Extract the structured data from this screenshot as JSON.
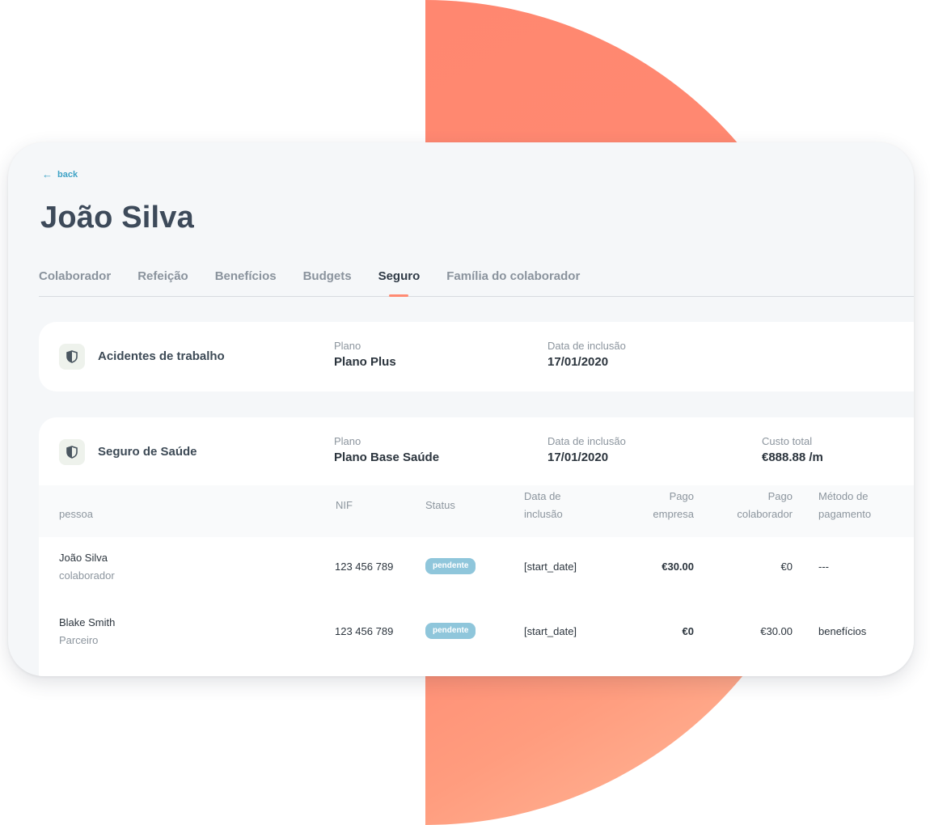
{
  "back_label": "back",
  "page_title": "João Silva",
  "tabs": [
    {
      "label": "Colaborador"
    },
    {
      "label": "Refeição"
    },
    {
      "label": "Benefícios"
    },
    {
      "label": "Budgets"
    },
    {
      "label": "Seguro",
      "active": true
    },
    {
      "label": "Família do colaborador"
    }
  ],
  "insurance_work": {
    "name": "Acidentes de trabalho",
    "plan_label": "Plano",
    "plan_value": "Plano Plus",
    "date_label": "Data de inclusão",
    "date_value": "17/01/2020"
  },
  "insurance_health": {
    "name": "Seguro de Saúde",
    "plan_label": "Plano",
    "plan_value": "Plano Base Saúde",
    "date_label": "Data de inclusão",
    "date_value": "17/01/2020",
    "cost_label": "Custo total",
    "cost_value": "€888.88 /m",
    "table": {
      "headers": {
        "person": "pessoa",
        "nif": "NIF",
        "status": "Status",
        "date_l1": "Data de",
        "date_l2": "inclusão",
        "company_l1": "Pago",
        "company_l2": "empresa",
        "employee_l1": "Pago",
        "employee_l2": "colaborador",
        "method_l1": "Método de",
        "method_l2": "pagamento"
      },
      "rows": [
        {
          "name": "João Silva",
          "role": "colaborador",
          "nif": "123 456 789",
          "status": "pendente",
          "date": "[start_date]",
          "paid_company": "€30.00",
          "paid_employee": "€0",
          "method": "---"
        },
        {
          "name": "Blake Smith",
          "role": "Parceiro",
          "nif": "123 456 789",
          "status": "pendente",
          "date": "[start_date]",
          "paid_company": "€0",
          "paid_employee": "€30.00",
          "method": "benefícios"
        }
      ]
    }
  },
  "colors": {
    "accent": "#ff8a72",
    "link": "#3fa3c6",
    "status_pill": "#8fc6db"
  }
}
